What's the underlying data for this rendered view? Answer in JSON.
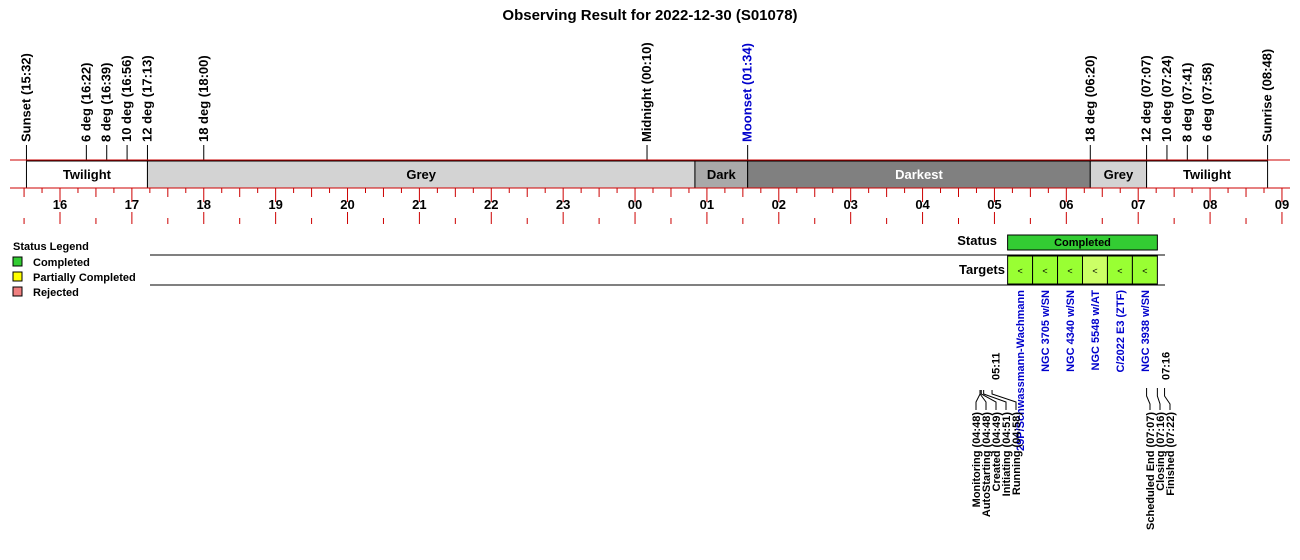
{
  "title": "Observing Result for 2022-12-30 (S01078)",
  "chart_data": {
    "type": "timeline",
    "time_axis": {
      "start": "15:32",
      "end": "09:00",
      "tick_labels": [
        "16",
        "17",
        "18",
        "19",
        "20",
        "21",
        "22",
        "23",
        "00",
        "01",
        "02",
        "03",
        "04",
        "05",
        "06",
        "07",
        "08",
        "09"
      ]
    },
    "events": [
      {
        "label": "Sunset (15:32)",
        "time": "15:32",
        "color": "#000000"
      },
      {
        "label": "6 deg (16:22)",
        "time": "16:22",
        "color": "#000000"
      },
      {
        "label": "8 deg (16:39)",
        "time": "16:39",
        "color": "#000000"
      },
      {
        "label": "10 deg (16:56)",
        "time": "16:56",
        "color": "#000000"
      },
      {
        "label": "12 deg (17:13)",
        "time": "17:13",
        "color": "#000000"
      },
      {
        "label": "18 deg (18:00)",
        "time": "18:00",
        "color": "#000000"
      },
      {
        "label": "Midnight (00:10)",
        "time": "00:10",
        "color": "#000000"
      },
      {
        "label": "Moonset (01:34)",
        "time": "01:34",
        "color": "#0000cc"
      },
      {
        "label": "18 deg (06:20)",
        "time": "06:20",
        "color": "#000000"
      },
      {
        "label": "12 deg (07:07)",
        "time": "07:07",
        "color": "#000000"
      },
      {
        "label": "10 deg (07:24)",
        "time": "07:24",
        "color": "#000000"
      },
      {
        "label": "8 deg (07:41)",
        "time": "07:41",
        "color": "#000000"
      },
      {
        "label": "6 deg (07:58)",
        "time": "07:58",
        "color": "#000000"
      },
      {
        "label": "Sunrise (08:48)",
        "time": "08:48",
        "color": "#000000"
      }
    ],
    "sky_bands": [
      {
        "label": "Twilight",
        "start": "15:32",
        "end": "17:13",
        "fill": "#ffffff",
        "text_color": "#000000"
      },
      {
        "label": "Grey",
        "start": "17:13",
        "end": "00:50",
        "fill": "#d3d3d3",
        "text_color": "#000000"
      },
      {
        "label": "Dark",
        "start": "00:50",
        "end": "01:34",
        "fill": "#a9a9a9",
        "text_color": "#000000"
      },
      {
        "label": "Darkest",
        "start": "01:34",
        "end": "06:20",
        "fill": "#808080",
        "text_color": "#ffffff"
      },
      {
        "label": "Grey",
        "start": "06:20",
        "end": "07:07",
        "fill": "#d3d3d3",
        "text_color": "#000000"
      },
      {
        "label": "Twilight",
        "start": "07:07",
        "end": "08:48",
        "fill": "#ffffff",
        "text_color": "#000000"
      }
    ],
    "rows": {
      "status_label": "Status",
      "targets_label": "Targets"
    },
    "status_bar": {
      "label": "Completed",
      "start": "05:11",
      "end": "07:16",
      "color": "#33cc33"
    },
    "targets": [
      {
        "name": "29P/Schwassmann-Wachmann",
        "color": "#99ff33"
      },
      {
        "name": "NGC 3705 w/SN",
        "color": "#99ff33"
      },
      {
        "name": "NGC 4340 w/SN",
        "color": "#99ff33"
      },
      {
        "name": "NGC 5548 w/AT",
        "color": "#ccff66"
      },
      {
        "name": "C/2022 E3 (ZTF)",
        "color": "#99ff33"
      },
      {
        "name": "NGC 3938 w/SN",
        "color": "#99ff33"
      }
    ],
    "target_marker": "<",
    "time_marks": {
      "start": "05:11",
      "end": "07:16"
    },
    "start_events": [
      "Monitoring (04:48)",
      "AutoStarting (04:48)",
      "Created (04:49)",
      "Initiating (04:51)",
      "Running (04:58)"
    ],
    "end_events": [
      "Scheduled End (07:07)",
      "Closing (07:16)",
      "Finished (07:22)"
    ],
    "legend": {
      "title": "Status Legend",
      "placement": "left",
      "items": [
        {
          "label": "Completed",
          "color": "#33cc33"
        },
        {
          "label": "Partially Completed",
          "color": "#ffff00"
        },
        {
          "label": "Rejected",
          "color": "#f08080"
        }
      ]
    }
  }
}
